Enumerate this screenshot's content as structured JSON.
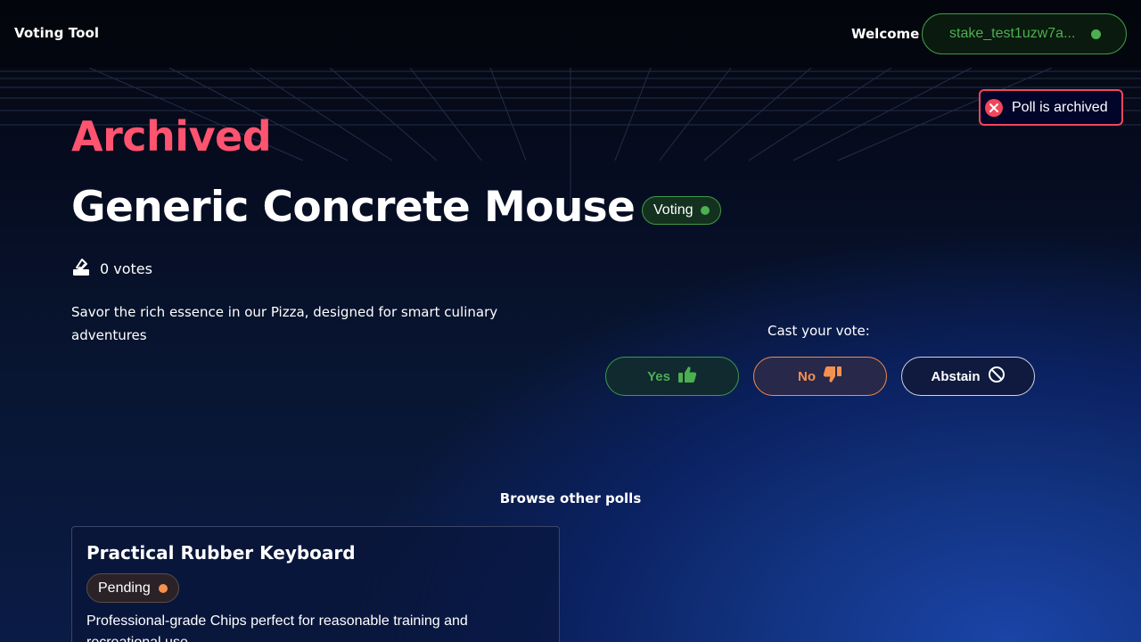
{
  "header": {
    "brand": "Voting Tool",
    "welcome": "Welcome",
    "wallet_address": "stake_test1uzw7a...",
    "wallet_status_color": "#4caf50"
  },
  "toast": {
    "message": "Poll is archived",
    "color": "#f2465a"
  },
  "poll": {
    "state_heading": "Archived",
    "title": "Generic Concrete Mouse",
    "status": "Voting",
    "status_color": "#4caf50",
    "votes": "0 votes",
    "description": "Savor the rich essence in our Pizza, designed for smart culinary adventures"
  },
  "vote": {
    "prompt": "Cast your vote:",
    "options": [
      {
        "label": "Yes",
        "icon": "thumbs-up-icon",
        "color": "#4caf50"
      },
      {
        "label": "No",
        "icon": "thumbs-down-icon",
        "color": "#f5914f"
      },
      {
        "label": "Abstain",
        "icon": "block-icon",
        "color": "#ffffff"
      }
    ]
  },
  "browse": {
    "heading": "Browse other polls",
    "polls": [
      {
        "title": "Practical Rubber Keyboard",
        "status": "Pending",
        "status_color": "#f5914f",
        "description": "Professional-grade Chips perfect for reasonable training and recreational use"
      }
    ]
  },
  "colors": {
    "archived": "#ff5470",
    "accent_green": "#4caf50",
    "accent_orange": "#f5914f"
  }
}
